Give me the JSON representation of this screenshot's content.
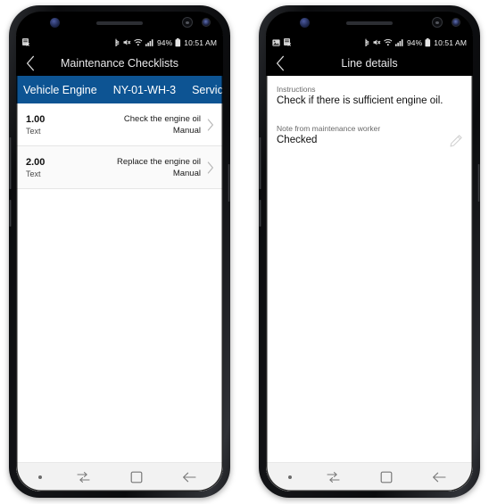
{
  "phones": [
    {
      "id": "checklist-phone",
      "status_bar": {
        "left_icons": [
          "app-icon"
        ],
        "right_icons": [
          "bluetooth-icon",
          "mute-icon",
          "wifi-icon",
          "signal-icon",
          "battery-icon"
        ],
        "battery_percent": "94%",
        "time": "10:51 AM"
      },
      "titlebar": {
        "back_label": "back",
        "title": "Maintenance Checklists"
      },
      "context_bar": {
        "background": "#0d5493",
        "items": [
          "Vehicle Engine",
          "NY-01-WH-3",
          "Service"
        ]
      },
      "rows": [
        {
          "number": "1.00",
          "subtitle": "Text",
          "title": "Check the engine oil",
          "meta": "Manual"
        },
        {
          "number": "2.00",
          "subtitle": "Text",
          "title": "Replace the engine oil",
          "meta": "Manual"
        }
      ],
      "navbar": {
        "items": [
          "dot-indicator",
          "recent-apps-icon",
          "home-icon",
          "back-icon"
        ]
      }
    },
    {
      "id": "details-phone",
      "status_bar": {
        "left_icons": [
          "image-icon",
          "app-icon"
        ],
        "right_icons": [
          "bluetooth-icon",
          "mute-icon",
          "wifi-icon",
          "signal-icon",
          "battery-icon"
        ],
        "battery_percent": "94%",
        "time": "10:51 AM"
      },
      "titlebar": {
        "back_label": "back",
        "title": "Line details"
      },
      "fields": [
        {
          "label": "Instructions",
          "value": "Check if there is sufficient engine oil.",
          "editable": false
        },
        {
          "label": "Note from maintenance worker",
          "value": "Checked",
          "editable": true
        }
      ],
      "navbar": {
        "items": [
          "dot-indicator",
          "recent-apps-icon",
          "home-icon",
          "back-icon"
        ]
      }
    }
  ],
  "colors": {
    "accent_blue": "#0d5493",
    "status_bar_bg": "#000000",
    "screen_bg": "#ffffff",
    "nav_bg": "#f2f2f2"
  }
}
